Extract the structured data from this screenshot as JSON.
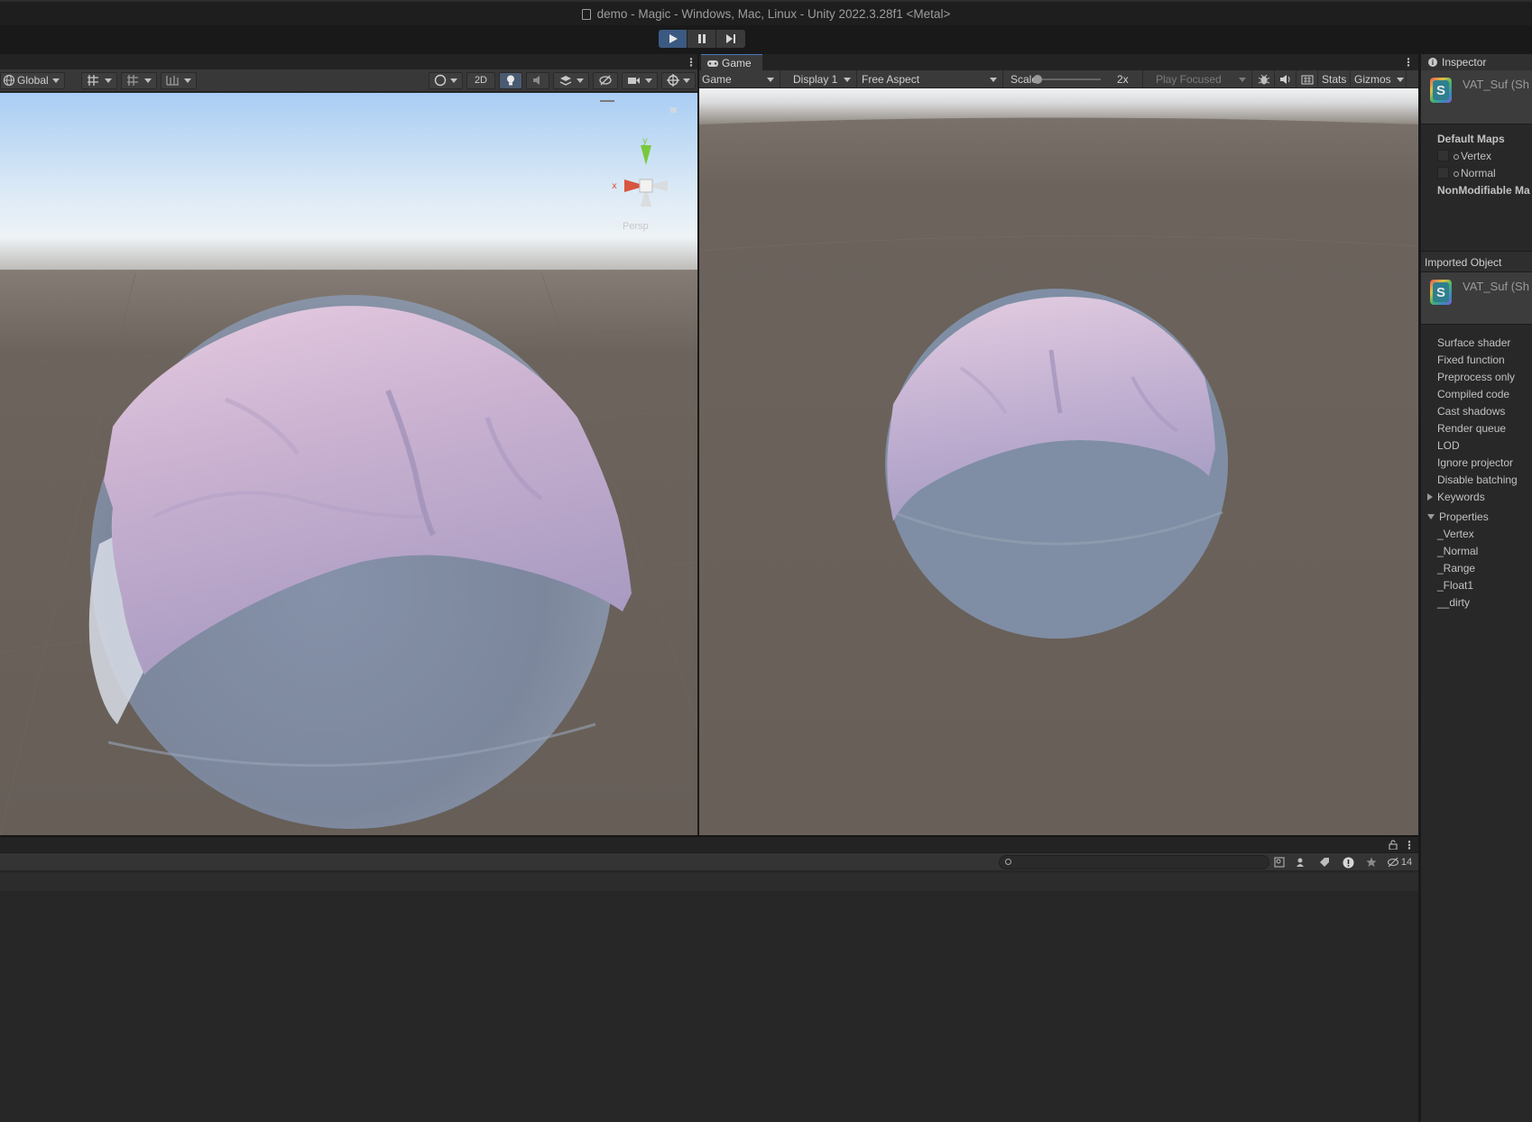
{
  "window": {
    "title": "demo - Magic - Windows, Mac, Linux - Unity 2022.3.28f1 <Metal>"
  },
  "playbar": {
    "play_icon": "play-icon",
    "pause_icon": "pause-icon",
    "step_icon": "step-icon",
    "accent": "#3b5a82"
  },
  "scene": {
    "pivot_label": "Global",
    "mode_2d_label": "2D",
    "gizmo": {
      "y_label": "y",
      "x_label": "x",
      "projection_label": "Persp"
    },
    "colors": {
      "sky_top": "#a8ccf2",
      "horizon": "#e8f1f8",
      "ground": "#6a625a",
      "cloth": "#cdb4d0",
      "sphere": "#8090a8"
    }
  },
  "game": {
    "tab_label": "Game",
    "view_dropdown": "Game",
    "display_dropdown": "Display 1",
    "aspect_dropdown": "Free Aspect",
    "scale_label": "Scale",
    "scale_value": "2x",
    "play_mode_dropdown": "Play Focused",
    "stats_label": "Stats",
    "gizmos_label": "Gizmos"
  },
  "inspector": {
    "tab_label": "Inspector",
    "asset_name": "VAT_Suf (Sh",
    "asset_icon_letter": "S",
    "default_maps_label": "Default Maps",
    "maps": [
      {
        "label": "Vertex"
      },
      {
        "label": "Normal"
      }
    ],
    "non_modifiable_label": "NonModifiable Ma",
    "imported_object_label": "Imported Object",
    "imported_asset_name": "VAT_Suf (Sh",
    "info_rows": [
      "Surface shader",
      "Fixed function",
      "Preprocess only",
      "Compiled code",
      "Cast shadows",
      "Render queue",
      "LOD",
      "Ignore projector",
      "Disable batching"
    ],
    "keywords_label": "Keywords",
    "properties_label": "Properties",
    "properties": [
      "_Vertex",
      "_Normal",
      "_Range",
      "_Float1",
      "__dirty"
    ]
  },
  "console": {
    "hidden_count": "14"
  }
}
